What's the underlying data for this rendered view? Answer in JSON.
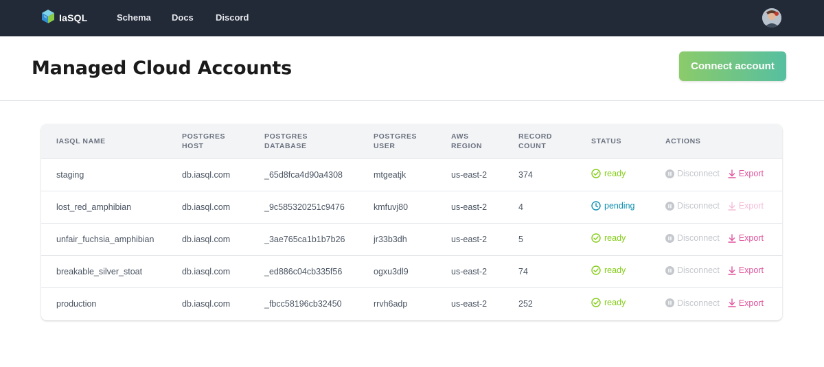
{
  "nav": {
    "brand": "IaSQL",
    "links": [
      "Schema",
      "Docs",
      "Discord"
    ]
  },
  "header": {
    "title": "Managed Cloud Accounts",
    "connect_button": "Connect account"
  },
  "table": {
    "columns": [
      [
        "IASQL NAME"
      ],
      [
        "POSTGRES",
        "HOST"
      ],
      [
        "POSTGRES",
        "DATABASE"
      ],
      [
        "POSTGRES",
        "USER"
      ],
      [
        "AWS",
        "REGION"
      ],
      [
        "RECORD",
        "COUNT"
      ],
      [
        "STATUS"
      ],
      [
        "ACTIONS"
      ]
    ],
    "rows": [
      {
        "name": "staging",
        "host": "db.iasql.com",
        "database": "_65d8fca4d90a4308",
        "user": "mtgeatjk",
        "region": "us-east-2",
        "count": "374",
        "status": "ready",
        "export_enabled": true
      },
      {
        "name": "lost_red_amphibian",
        "host": "db.iasql.com",
        "database": "_9c585320251c9476",
        "user": "kmfuvj80",
        "region": "us-east-2",
        "count": "4",
        "status": "pending",
        "export_enabled": false
      },
      {
        "name": "unfair_fuchsia_amphibian",
        "host": "db.iasql.com",
        "database": "_3ae765ca1b1b7b26",
        "user": "jr33b3dh",
        "region": "us-east-2",
        "count": "5",
        "status": "ready",
        "export_enabled": true
      },
      {
        "name": "breakable_silver_stoat",
        "host": "db.iasql.com",
        "database": "_ed886c04cb335f56",
        "user": "ogxu3dl9",
        "region": "us-east-2",
        "count": "74",
        "status": "ready",
        "export_enabled": true
      },
      {
        "name": "production",
        "host": "db.iasql.com",
        "database": "_fbcc58196cb32450",
        "user": "rrvh6adp",
        "region": "us-east-2",
        "count": "252",
        "status": "ready",
        "export_enabled": true
      }
    ],
    "actions": {
      "disconnect_label": "Disconnect",
      "export_label": "Export"
    }
  },
  "colors": {
    "navbar_bg": "#222a38",
    "ready": "#84cc16",
    "pending": "#0e8fb0",
    "export": "#e0529c",
    "disconnect": "#c4c7cc",
    "button_gradient_start": "#8bcb6a",
    "button_gradient_end": "#56bfa0"
  },
  "icons": {
    "logo": "iasql-cube-logo",
    "ready": "check-circle-icon",
    "pending": "clock-icon",
    "disconnect": "pause-circle-icon",
    "export": "download-icon"
  }
}
